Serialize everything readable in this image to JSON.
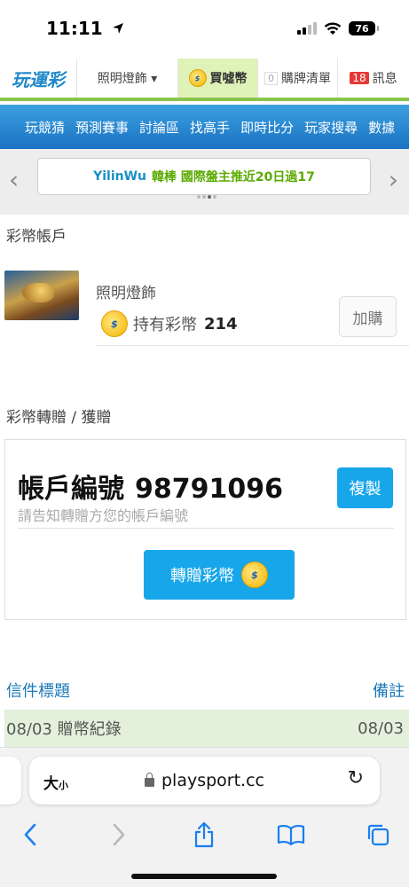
{
  "status_bar": {
    "time": "11:11",
    "battery": "76"
  },
  "site_nav": {
    "logo": "玩運彩",
    "user_menu": "照明燈飾 ▾",
    "buy": "買噓幣",
    "shopping_list_count": "0",
    "shopping_list": "購牌清單",
    "messages_count": "18",
    "messages": "訊息"
  },
  "blue_menu": [
    "玩競猜",
    "預測賽事",
    "討論區",
    "找高手",
    "即時比分",
    "玩家搜尋",
    "數據"
  ],
  "ticker": {
    "user": "YilinWu",
    "text": "韓棒 國際盤主推近20日過17"
  },
  "account_section": {
    "title": "彩幣帳戶",
    "name": "照明燈飾",
    "holding_label": "持有彩幣",
    "holding_value": "214",
    "add_button": "加購"
  },
  "transfer_section": {
    "title": "彩幣轉贈 / 獲贈",
    "account_label": "帳戶編號",
    "account_number": "98791096",
    "hint": "請告知轉贈方您的帳戶編號",
    "copy_button": "複製",
    "transfer_button": "轉贈彩幣"
  },
  "mail": {
    "header_title": "信件標題",
    "header_note": "備註",
    "rows": [
      {
        "title": "08/03 贈幣紀錄",
        "note": "08/03"
      }
    ]
  },
  "safari": {
    "text_size": "大",
    "text_size_small": "小",
    "url": "playsport.cc"
  },
  "colors": {
    "accent_blue": "#18a6ea",
    "nav_green": "#8bc34a",
    "menu_blue": "#1a72c2",
    "ticker_green": "#5aaa00"
  },
  "icons": [
    "location-arrow-icon",
    "signal-icon",
    "wifi-icon",
    "battery-icon",
    "coin-icon",
    "lock-icon",
    "reload-icon",
    "back-icon",
    "forward-icon",
    "share-icon",
    "bookmarks-icon",
    "tabs-icon"
  ]
}
